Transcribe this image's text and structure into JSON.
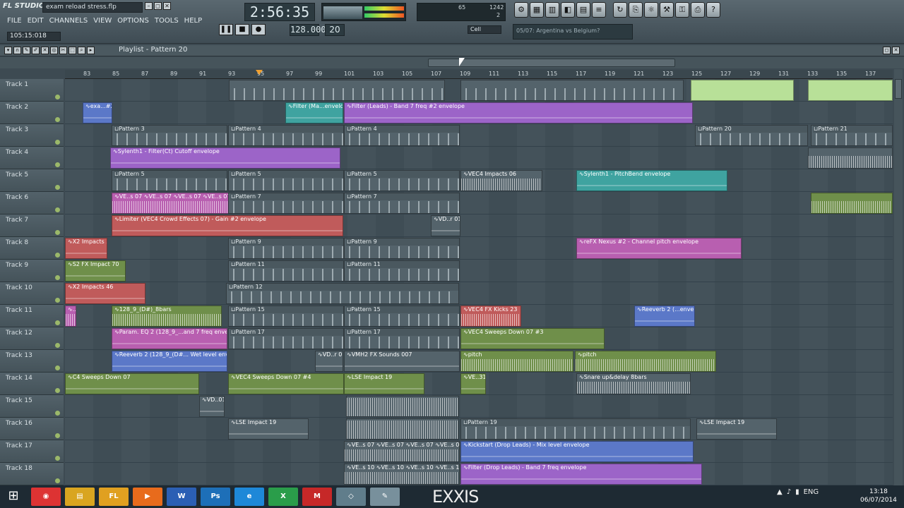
{
  "app": {
    "logo": "FL STUDIO",
    "project_file": "exam reload stress.flp",
    "hint_time": "105:15:018"
  },
  "menu": [
    "FILE",
    "EDIT",
    "CHANNELS",
    "VIEW",
    "OPTIONS",
    "TOOLS",
    "HELP"
  ],
  "transport": {
    "song_time": "2:56:35",
    "tempo": "128.000",
    "pattern": "20",
    "snap": "Cell",
    "hint_text": "05/07: Argentina vs Belgium?",
    "pat_label": "PAT",
    "song_label": "SONG",
    "play": "▶",
    "pause": "❚❚",
    "stop": "■",
    "record": "●",
    "cpu_val": "65",
    "cpu_ram": "1242",
    "cpu_voices": "2"
  },
  "tools": [
    "⚙",
    "▦",
    "▥",
    "◧",
    "▤",
    "≡",
    "↻",
    "⎘",
    "⚛",
    "⚒",
    "⚿",
    "⎙",
    "?"
  ],
  "playlist": {
    "title": "Playlist - Pattern 20"
  },
  "ruler": {
    "major": [
      "83",
      "85",
      "87",
      "89",
      "91",
      "93",
      "95",
      "97",
      "99",
      "101",
      "103",
      "105",
      "107",
      "109",
      "111",
      "113",
      "115",
      "117",
      "119",
      "121",
      "123",
      "125",
      "127",
      "129",
      "131",
      "133",
      "135",
      "137"
    ]
  },
  "tracks": [
    "Track 1",
    "Track 2",
    "Track 3",
    "Track 4",
    "Track 5",
    "Track 6",
    "Track 7",
    "Track 8",
    "Track 9",
    "Track 10",
    "Track 11",
    "Track 12",
    "Track 13",
    "Track 14",
    "Track 15",
    "Track 16",
    "Track 17",
    "Track 18"
  ],
  "clips": {
    "t2a": "∿exa...#2",
    "t2b": "∿Filter (Ma...envelope",
    "t2c": "∿Filter (Leads) - Band 7 freq #2 envelope",
    "t3a": "⊔Pattern 3",
    "t3b": "⊔Pattern 4",
    "t3c": "⊔Pattern 4",
    "t3d": "⊔Pattern 20",
    "t3e": "⊔Pattern 21",
    "t4a": "∿Sylenth1 - Filter(Ct) Cutoff envelope",
    "t5a": "⊔Pattern 5",
    "t5b": "⊔Pattern 5",
    "t5c": "⊔Pattern 5",
    "t5d": "∿VEC4 Impacts 06",
    "t5e": "∿Sylenth1 - PitchBend envelope",
    "t6a": "∿VE..s 07  ∿VE..s 07  ∿VE..s 07  ∿VE..s 07",
    "t6b": "⊔Pattern 7",
    "t6c": "⊔Pattern 7",
    "t7a": "∿Limiter (VEC4 Crowd Effects 07) - Gain #2 envelope",
    "t7b": "∿VD..r 01",
    "t8a": "∿X2 Impacts 33",
    "t8b": "⊔Pattern 9",
    "t8c": "⊔Pattern 9",
    "t8d": "∿reFX Nexus #2 - Channel pitch envelope",
    "t9a": "∿S2 FX Impact 70",
    "t9b": "⊔Pattern 11",
    "t9c": "⊔Pattern 11",
    "t10a": "∿X2 Impacts 46",
    "t10b": "⊔Pattern 12",
    "t11a": "∿..6",
    "t11b": "∿128_9_(D#)_8bars",
    "t11c": "⊔Pattern 15",
    "t11d": "⊔Pattern 15",
    "t11e": "∿VEC4 FX Kicks 23",
    "t11f": "∿Reeverb 2 (...envelope",
    "t12a": "∿Param. EQ 2 (128_9_...and 7 freq envelope",
    "t12b": "⊔Pattern 17",
    "t12c": "⊔Pattern 17",
    "t12d": "∿VEC4 Sweeps Down 07 #3",
    "t13a": "∿Reeverb 2 (128_9_(D#... Wet level envelope",
    "t13b": "∿VD..r 01",
    "t13c": "∿VMH2 FX Sounds 007",
    "t13d": "∿pitch",
    "t13e": "∿pitch",
    "t14a": "∿C4 Sweeps Down 07",
    "t14b": "∿VEC4 Sweeps Down 07 #4",
    "t14c": "∿LSE Impact 19",
    "t14d": "∿VE..31",
    "t14e": "∿Snare up&delay 8bars",
    "t15a": "∿VD..01",
    "t16a": "∿LSE Impact 19",
    "t16b": "⊔Pattern 19",
    "t16c": "∿LSE Impact 19",
    "t17a": "∿VE..s 07  ∿VE..s 07  ∿VE..s 07  ∿VE..s 07",
    "t17b": "∿Kickstart (Drop Leads) - Mix level envelope",
    "t18a": "∿VE..s 10  ∿VE..s 10  ∿VE..s 10  ∿VE..s 10",
    "t18b": "∿Filter (Drop Leads) - Band 7 freq envelope"
  },
  "taskbar": {
    "start": "⊞",
    "brand": "EXXIS",
    "lang": "ENG",
    "time": "13:18",
    "date": "06/07/2014",
    "apps": [
      {
        "label": "◉",
        "color": "#d33"
      },
      {
        "label": "▤",
        "color": "#d9a520"
      },
      {
        "label": "FL",
        "color": "#e0a020"
      },
      {
        "label": "▶",
        "color": "#e86b1c"
      },
      {
        "label": "W",
        "color": "#2b5fb4"
      },
      {
        "label": "Ps",
        "color": "#1d6fb8"
      },
      {
        "label": "e",
        "color": "#1e88d8"
      },
      {
        "label": "X",
        "color": "#2a9d4a"
      },
      {
        "label": "M",
        "color": "#c62828"
      },
      {
        "label": "◇",
        "color": "#607d8b"
      },
      {
        "label": "✎",
        "color": "#78909c"
      }
    ]
  },
  "colors": {
    "purple": "#9c64c8",
    "green": "#6f8f4a",
    "teal": "#3fa3a0",
    "red": "#c05b5b",
    "pink": "#b85fb0",
    "blue": "#5b78c8",
    "lime": "#b8e098"
  }
}
